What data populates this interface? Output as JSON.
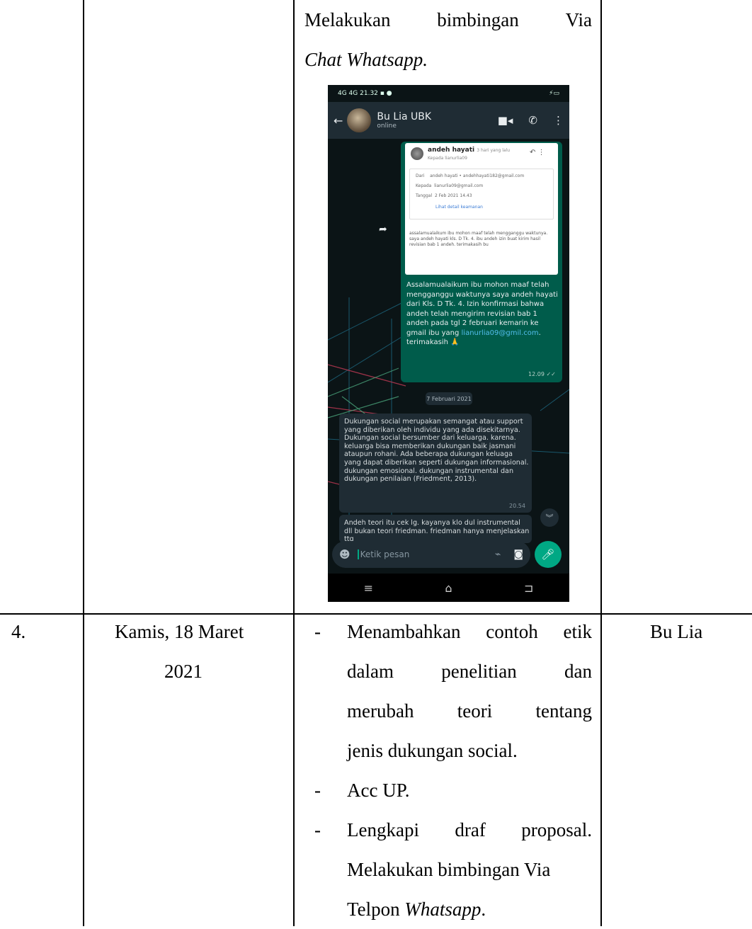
{
  "top_row": {
    "line1": [
      "Melakukan",
      "bimbingan",
      "Via"
    ],
    "line2": "Chat Whatsapp."
  },
  "phone": {
    "status_time": "21.32",
    "status_left": "4G 4G",
    "contact_name": "Bu Lia UBK",
    "contact_status": "online",
    "email": {
      "sender": "andeh hayati",
      "sender_time": "3 hari yang lalu",
      "to_line": "Kepada lianurlia09",
      "from_label": "Dari",
      "from_value": "andeh hayati • andehhayati182@gmail.com",
      "to_label": "Kepada",
      "to_value": "lianurlia09@gmail.com",
      "date_label": "Tanggal",
      "date_value": "2 Feb 2021 14.43",
      "security_link": "Lihat detail keamanan",
      "body": "assalamualaikum ibu mohon maaf telah mengganggu waktunya. saya andeh hayati kls. D Tk. 4. ibu andeh izin buat kirim hasil revisian bab 1 andeh. terimakasih bu"
    },
    "out_message": "Assalamualaikum ibu mohon maaf telah mengganggu waktunya saya andeh hayati dari Kls. D Tk. 4. Izin konfirmasi bahwa andeh telah mengirim revisian bab 1 andeh pada tgl 2 februari kemarin ke gmail ibu yang",
    "out_email": "lianurlia09@gmil.com",
    "out_suffix": ". terimakasih 🙏",
    "out_time": "12.09 ✓✓",
    "date_chip": "7 Februari 2021",
    "in_message": "Dukungan social merupakan semangat atau support yang diberikan oleh individu yang ada disekitarnya. Dukungan social bersumber dari keluarga. karena. keluarga bisa memberikan dukungan baik jasmani ataupun rohani. Ada beberapa dukungan keluaga yang dapat diberikan seperti dukungan informasional. dukungan emosional. dukungan instrumental dan dukungan penilaian (Friedment, 2013).",
    "in_time": "20.54",
    "in_message2": "Andeh teori itu cek lg. kayanya klo dul instrumental dll bukan teori friedman. friedman hanya menjelaskan ttg",
    "input_placeholder": "Ketik pesan",
    "icons": {
      "back": "arrow-left-icon",
      "video": "video-call-icon",
      "phone": "phone-call-icon",
      "menu": "more-vert-icon",
      "emoji": "emoji-icon",
      "attach": "paperclip-icon",
      "camera": "camera-icon",
      "mic": "mic-icon"
    },
    "colors": {
      "header": "#1f2c34",
      "outgoing": "#005c4b",
      "accent": "#00a884"
    }
  },
  "row4": {
    "no": "4.",
    "date_line1": "Kamis, 18 Maret",
    "date_line2": "2021",
    "items": [
      {
        "lines": [
          [
            "Menambahkan",
            "contoh",
            "etik"
          ],
          [
            "dalam",
            "penelitian",
            "dan"
          ],
          [
            "merubah",
            "teori",
            "tentang"
          ]
        ],
        "last": "jenis dukungan social."
      },
      {
        "last": "Acc UP."
      },
      {
        "lines": [
          [
            "Lengkapi",
            "draf",
            "proposal."
          ]
        ],
        "last2": "Melakukan bimbingan Via",
        "last3_plain": "Telpon ",
        "last3_italic": "Whatsapp",
        "last3_end": "."
      }
    ],
    "pembimbing": "Bu Lia"
  }
}
